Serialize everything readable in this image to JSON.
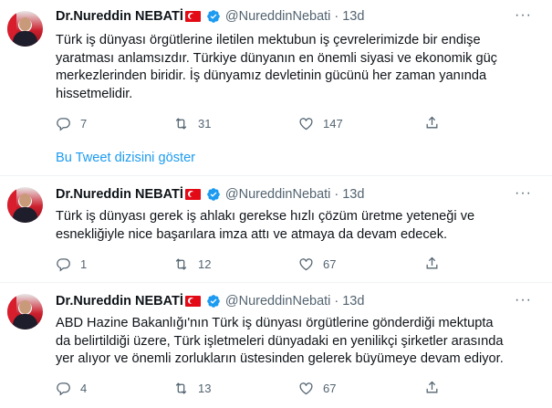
{
  "tweets": [
    {
      "name": "Dr.Nureddin NEBATİ",
      "handle": "@NureddinNebati",
      "dot": "·",
      "time": "13d",
      "lines": [
        "Türk iş dünyası örgütlerine iletilen mektubun iş çevrelerimizde bir endişe",
        "yaratması anlamsızdır. Türkiye dünyanın en önemli siyasi ve ekonomik güç",
        "merkezlerinden biridir. İş dünyamız devletinin gücünü her zaman yanında",
        "hissetmelidir."
      ],
      "replies": "7",
      "retweets": "31",
      "likes": "147"
    },
    {
      "name": "Dr.Nureddin NEBATİ",
      "handle": "@NureddinNebati",
      "dot": "·",
      "time": "13d",
      "lines": [
        "Türk iş dünyası gerek iş ahlakı gerekse hızlı çözüm üretme yeteneği ve",
        "esnekliğiyle nice başarılara imza attı ve atmaya da devam edecek."
      ],
      "replies": "1",
      "retweets": "12",
      "likes": "67"
    },
    {
      "name": "Dr.Nureddin NEBATİ",
      "handle": "@NureddinNebati",
      "dot": "·",
      "time": "13d",
      "lines": [
        "ABD Hazine Bakanlığı'nın Türk iş dünyası örgütlerine  gönderdiği mektupta",
        "da belirtildiği üzere, Türk işletmeleri dünyadaki en yenilikçi şirketler arasında",
        "yer alıyor ve önemli zorlukların üstesinden gelerek büyümeye devam ediyor."
      ],
      "replies": "4",
      "retweets": "13",
      "likes": "67"
    }
  ],
  "thread_link": "Bu Tweet dizisini göster",
  "more_label": "···",
  "icons": {
    "reply": "reply-icon",
    "retweet": "retweet-icon",
    "like": "heart-icon",
    "share": "share-icon",
    "verified": "verified-badge-icon",
    "flag": "turkey-flag-icon"
  },
  "colors": {
    "accent": "#1d9bf0",
    "secondary_text": "#536471",
    "primary_text": "#0f1419"
  }
}
